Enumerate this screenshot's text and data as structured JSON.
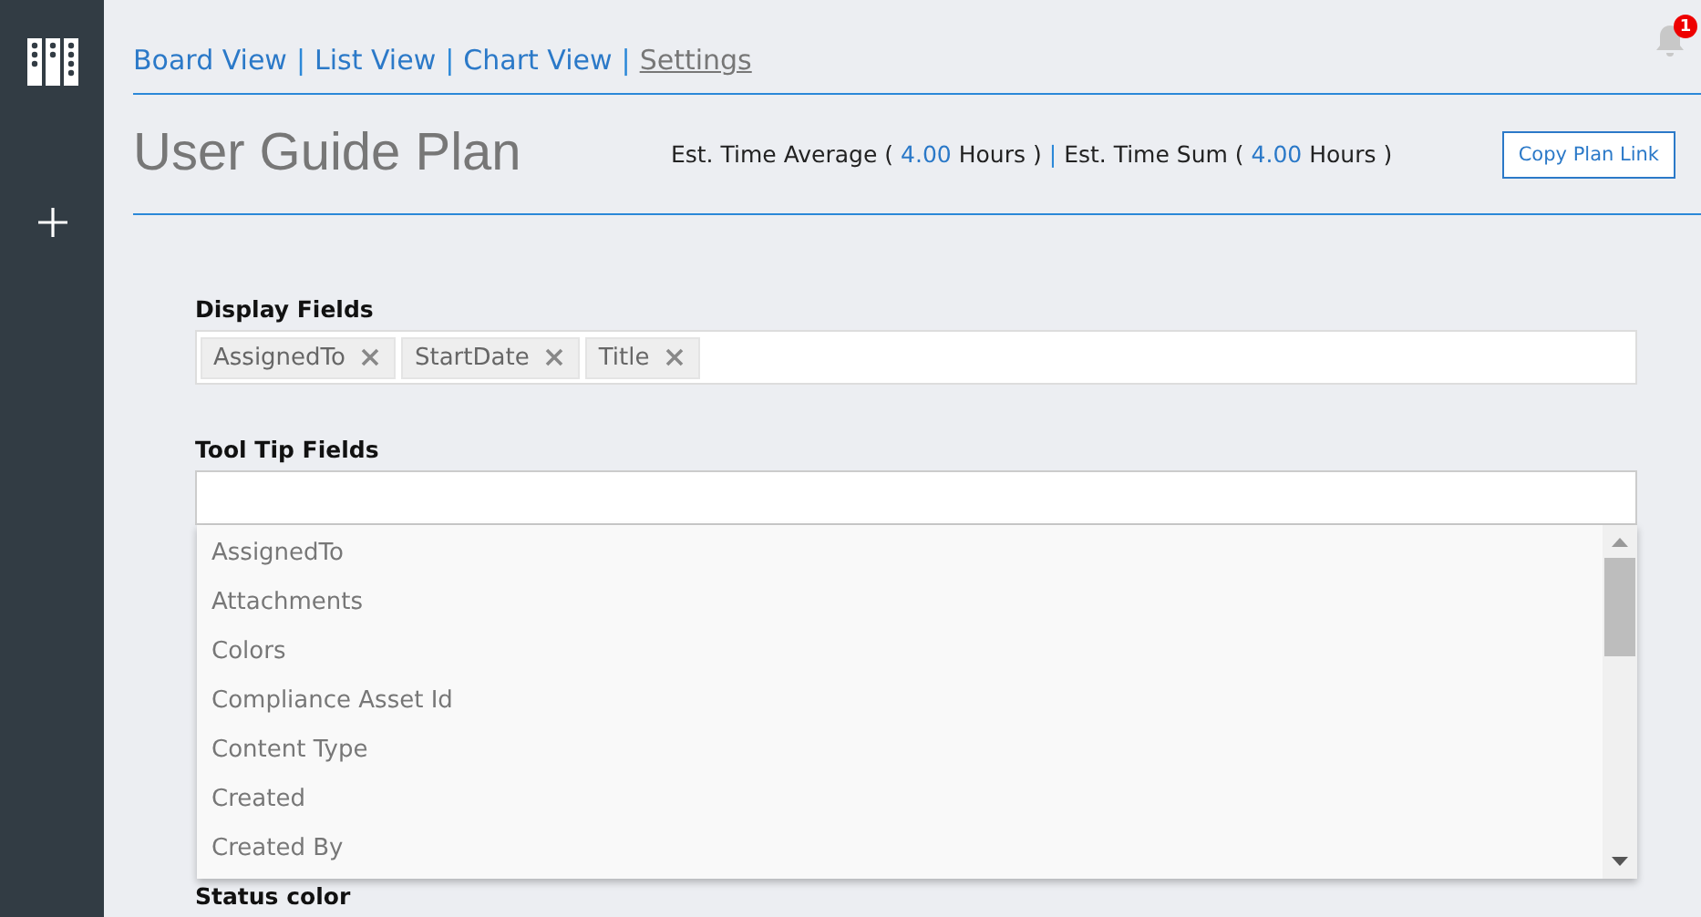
{
  "nav_separator": "|",
  "stats_separator": "|",
  "nav": [
    {
      "label": "Board View",
      "selected": false
    },
    {
      "label": "List View",
      "selected": false
    },
    {
      "label": "Chart View",
      "selected": false
    },
    {
      "label": "Settings",
      "selected": true
    }
  ],
  "notifications": {
    "count": "1"
  },
  "title": "User Guide Plan",
  "stats": [
    {
      "label": "Est. Time Average (",
      "value": "4.00",
      "unit": "Hours )"
    },
    {
      "label": "Est. Time Sum (",
      "value": "4.00",
      "unit": "Hours )"
    }
  ],
  "copy_button": "Copy Plan Link",
  "display_fields": {
    "label": "Display Fields",
    "tags": [
      "AssignedTo",
      "StartDate",
      "Title"
    ]
  },
  "tooltip_fields": {
    "label": "Tool Tip Fields",
    "options": [
      "AssignedTo",
      "Attachments",
      "Colors",
      "Compliance Asset Id",
      "Content Type",
      "Created",
      "Created By"
    ]
  },
  "status_label": "Status color"
}
